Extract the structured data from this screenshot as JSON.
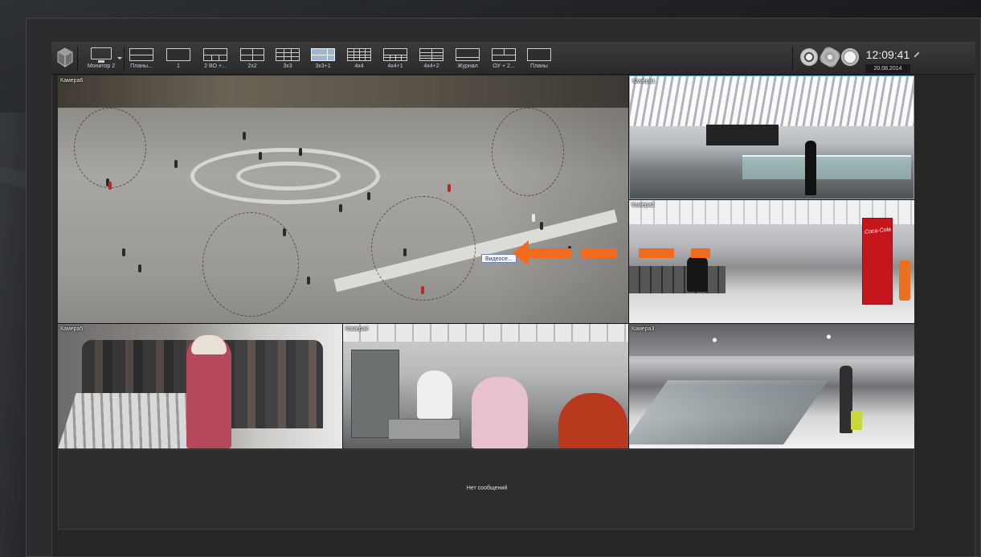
{
  "toolbar": {
    "monitor_label": "Монитор 2",
    "layouts": [
      {
        "label": "Планы..."
      },
      {
        "label": "1"
      },
      {
        "label": "2 ВО +..."
      },
      {
        "label": "2x2"
      },
      {
        "label": "3x3"
      },
      {
        "label": "3x3+1"
      },
      {
        "label": "4x4"
      },
      {
        "label": "4x4+1"
      },
      {
        "label": "4x4+2"
      },
      {
        "label": "Журнал"
      },
      {
        "label": "ОУ + 2..."
      },
      {
        "label": "Планы"
      }
    ],
    "active_layout": "3x3+1",
    "time": "12:09:41",
    "date": "20.08.2014",
    "icons": [
      "film-reel-icon",
      "settings-icon",
      "clock-icon",
      "pin-icon"
    ]
  },
  "cameras": {
    "cam6": {
      "label": "Камера6",
      "tag": "Видеосе..."
    },
    "cam1": {
      "label": "Камера1"
    },
    "cam2": {
      "label": "Камера2",
      "ad": "Coca-Cola"
    },
    "cam5": {
      "label": "Камера5"
    },
    "cam4": {
      "label": "Камера4"
    },
    "cam3": {
      "label": "Камера3"
    }
  },
  "colors": {
    "accent_arrow": "#f26b1d",
    "selected_border": "#6fb1d6",
    "active_layout": "#9fb6cf"
  },
  "messages": {
    "empty_text": "Нет сообщений"
  }
}
